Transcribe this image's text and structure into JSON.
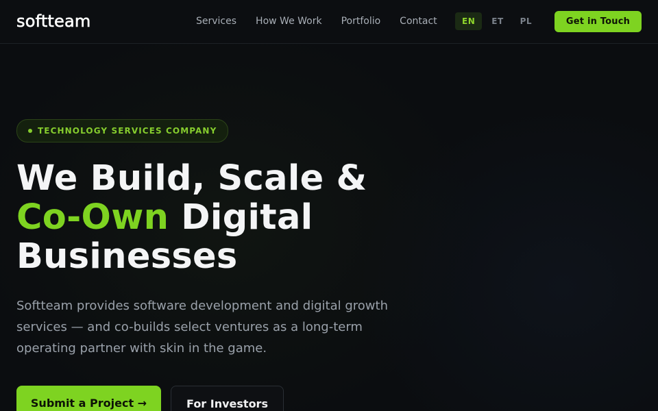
{
  "nav": {
    "logo": "softteam",
    "links": [
      "Services",
      "How We Work",
      "Portfolio",
      "Contact"
    ],
    "languages": [
      "EN",
      "ET",
      "PL"
    ],
    "active_language": "EN",
    "cta_label": "Get in Touch"
  },
  "hero": {
    "badge": "TECHNOLOGY SERVICES COMPANY",
    "headline_line1": "We Build, Scale &",
    "headline_accent": "Co-Own",
    "headline_line2_rest": " Digital",
    "headline_line3": "Businesses",
    "subtext": "Softteam provides software development and digital growth services — and co-builds select ventures as a long-term operating partner with skin in the game.",
    "primary_button": "Submit a Project →",
    "secondary_button": "For Investors"
  },
  "colors": {
    "accent": "#7ed321",
    "background": "#0b0d10"
  }
}
